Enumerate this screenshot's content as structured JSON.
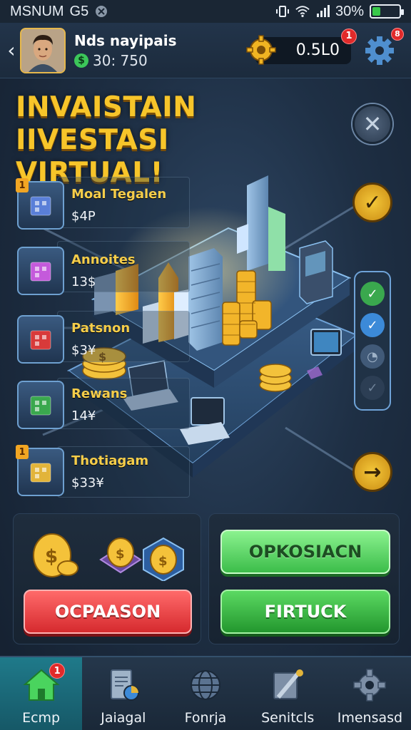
{
  "status_bar": {
    "left_text": "MSNUM",
    "left_text2": "G5",
    "battery_percent": "30%",
    "battery_level": 0.3
  },
  "header": {
    "player_name": "Nds nayipais",
    "player_balance": "30: 750",
    "currency_value": "0.5L0",
    "currency_badge": "1",
    "settings_badge": "8"
  },
  "title": {
    "line1": "INVAISTAIN IIVESTASI",
    "line2": "VIRTUAL!"
  },
  "investments": [
    {
      "badge": "1",
      "name": "Moal Tegalen",
      "price": "$4P"
    },
    {
      "badge": "",
      "name": "Annoites",
      "price": "13$"
    },
    {
      "badge": "",
      "name": "Patsnon",
      "price": "$3¥"
    },
    {
      "badge": "",
      "name": "Rewans",
      "price": "14¥"
    },
    {
      "badge": "1",
      "name": "Thotiagam",
      "price": "$33¥"
    }
  ],
  "buttons": {
    "red": "OCPAASON",
    "light_green": "OPKOSIACN",
    "dark_green": "FIRTUCK"
  },
  "nav": [
    {
      "label": "Ecmp",
      "icon": "home-icon",
      "badge": "1",
      "active": true
    },
    {
      "label": "Jaiagal",
      "icon": "document-chart-icon",
      "badge": ""
    },
    {
      "label": "Fonrja",
      "icon": "globe-icon",
      "badge": ""
    },
    {
      "label": "Senitcls",
      "icon": "tools-icon",
      "badge": ""
    },
    {
      "label": "Imensasd",
      "icon": "gear-icon",
      "badge": ""
    }
  ],
  "colors": {
    "title": "#f7c52a",
    "accent_gold": "#f2a623",
    "badge_red": "#e12a2a",
    "nav_active": "#1f7a8a"
  }
}
